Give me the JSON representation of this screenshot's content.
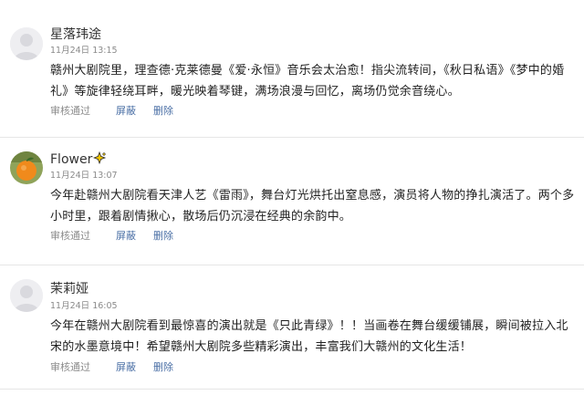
{
  "comments": [
    {
      "username": "星落玮途",
      "time": "11月24日 13:15",
      "avatar": "default-avatar",
      "text": "赣州大剧院里，理查德·克莱德曼《爱·永恒》音乐会太治愈！指尖流转间，《秋日私语》《梦中的婚礼》等旋律轻绕耳畔，暖光映着琴键，满场浪漫与回忆，离场仍觉余音绕心。",
      "status": "审核通过",
      "hide_label": "屏蔽",
      "delete_label": "删除"
    },
    {
      "username": "Flower",
      "time": "11月24日 13:07",
      "avatar": "orange-fruit-avatar",
      "badge_icon": "sparkle-icon",
      "text": "今年赴赣州大剧院看天津人艺《雷雨》，舞台灯光烘托出窒息感，演员将人物的挣扎演活了。两个多小时里，跟着剧情揪心，散场后仍沉浸在经典的余韵中。",
      "status": "审核通过",
      "hide_label": "屏蔽",
      "delete_label": "删除"
    },
    {
      "username": "茉莉娅",
      "time": "11月24日 16:05",
      "avatar": "default-avatar",
      "text": "今年在赣州大剧院看到最惊喜的演出就是《只此青绿》！！当画卷在舞台缓缓铺展，瞬间被拉入北宋的水墨意境中！希望赣州大剧院多些精彩演出，丰富我们大赣州的文化生活！",
      "status": "审核通过",
      "hide_label": "屏蔽",
      "delete_label": "删除"
    }
  ],
  "colors": {
    "link": "#4a6fa5",
    "muted": "#8c8c8c",
    "text": "#1f1f1f",
    "divider": "#e6e6e6"
  }
}
